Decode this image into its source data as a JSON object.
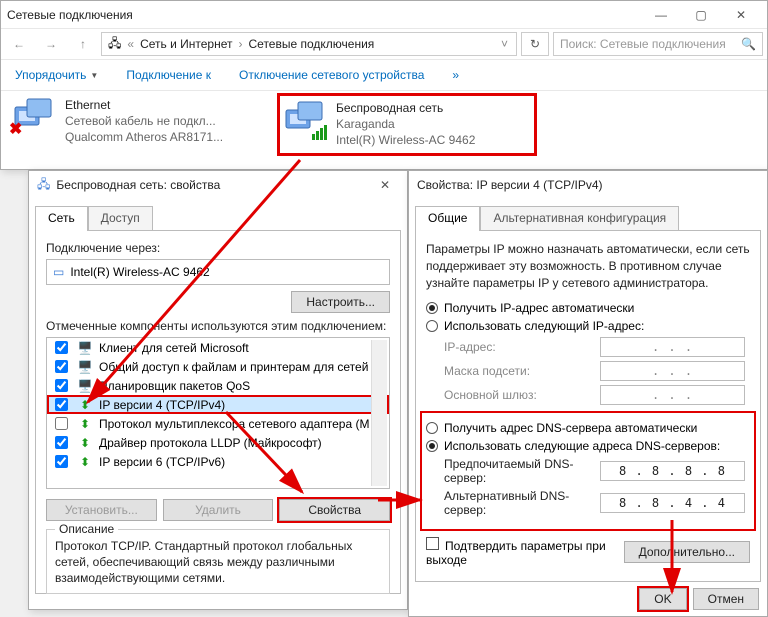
{
  "explorer": {
    "title": "Сетевые подключения",
    "breadcrumb": [
      "Сеть и Интернет",
      "Сетевые подключения"
    ],
    "search_placeholder": "Поиск: Сетевые подключения",
    "cmds": {
      "organize": "Упорядочить",
      "connect": "Подключение к",
      "disable": "Отключение сетевого устройства"
    }
  },
  "adapters": {
    "eth": {
      "name": "Ethernet",
      "status": "Сетевой кабель не подкл...",
      "hw": "Qualcomm Atheros AR8171..."
    },
    "wifi": {
      "name": "Беспроводная сеть",
      "status": "Karaganda",
      "hw": "Intel(R) Wireless-AC 9462"
    }
  },
  "props": {
    "title": "Беспроводная сеть: свойства",
    "tabs": {
      "net": "Сеть",
      "access": "Доступ"
    },
    "connect_via": "Подключение через:",
    "adapter": "Intel(R) Wireless-AC 9462",
    "configure": "Настроить...",
    "components_label": "Отмеченные компоненты используются этим подключением:",
    "components": [
      "Клиент для сетей Microsoft",
      "Общий доступ к файлам и принтерам для сетей Mi...",
      "Планировщик пакетов QoS",
      "IP версии 4 (TCP/IPv4)",
      "Протокол мультиплексора сетевого адаптера (Май...",
      "Драйвер протокола LLDP (Майкрософт)",
      "IP версии 6 (TCP/IPv6)",
      "—"
    ],
    "install": "Установить...",
    "uninstall": "Удалить",
    "properties": "Свойства",
    "desc_legend": "Описание",
    "desc": "Протокол TCP/IP. Стандартный протокол глобальных сетей, обеспечивающий связь между различными взаимодействующими сетями."
  },
  "ipv4": {
    "title": "Свойства: IP версии 4 (TCP/IPv4)",
    "tabs": {
      "general": "Общие",
      "alt": "Альтернативная конфигурация"
    },
    "intro": "Параметры IP можно назначать автоматически, если сеть поддерживает эту возможность. В противном случае узнайте параметры IP у сетевого администратора.",
    "auto_ip": "Получить IP-адрес автоматически",
    "manual_ip": "Использовать следующий IP-адрес:",
    "ip_label": "IP-адрес:",
    "mask_label": "Маска подсети:",
    "gw_label": "Основной шлюз:",
    "dot_placeholder": ".   .   .",
    "auto_dns": "Получить адрес DNS-сервера автоматически",
    "manual_dns": "Использовать следующие адреса DNS-серверов:",
    "pref_dns_label": "Предпочитаемый DNS-сервер:",
    "alt_dns_label": "Альтернативный DNS-сервер:",
    "pref_dns": "8 . 8 . 8 . 8",
    "alt_dns": "8 . 8 . 4 . 4",
    "validate": "Подтвердить параметры при выходе",
    "advanced": "Дополнительно...",
    "ok": "OK",
    "cancel": "Отмен"
  }
}
